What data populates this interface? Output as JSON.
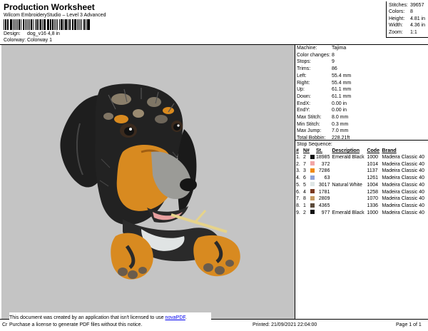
{
  "header": {
    "title": "Production Worksheet",
    "subtitle": "Wilcom EmbroideryStudio – Level 3 Advanced",
    "design_label": "Design:",
    "design_value": "dog_v16 4,8 in",
    "colorway_label": "Colorway:",
    "colorway_value": "Colorway 1"
  },
  "stats": [
    {
      "label": "Stitches:",
      "value": "39657"
    },
    {
      "label": "Colors:",
      "value": "8"
    },
    {
      "label": "Height:",
      "value": "4.81 in"
    },
    {
      "label": "Width:",
      "value": "4.36 in"
    },
    {
      "label": "Zoom:",
      "value": "1:1"
    }
  ],
  "machine_info": [
    {
      "label": "Machine:",
      "value": "Tajima"
    },
    {
      "label": "Color changes:",
      "value": "8"
    },
    {
      "label": "Stops:",
      "value": "9"
    },
    {
      "label": "Trims:",
      "value": "86"
    },
    {
      "label": "Left:",
      "value": "55.4 mm"
    },
    {
      "label": "Right:",
      "value": "55.4 mm"
    },
    {
      "label": "Up:",
      "value": "61.1 mm"
    },
    {
      "label": "Down:",
      "value": "61.1 mm"
    },
    {
      "label": "EndX:",
      "value": "0.00 in"
    },
    {
      "label": "EndY:",
      "value": "0.00 in"
    },
    {
      "label": "Max Stitch:",
      "value": "8.0 mm"
    },
    {
      "label": "Min Stitch:",
      "value": "0.3 mm"
    },
    {
      "label": "Max Jump:",
      "value": "7.0 mm"
    },
    {
      "label": "Total Bobbin:",
      "value": "228.21ft"
    }
  ],
  "stop_sequence": {
    "title": "Stop Sequence:",
    "columns": [
      "#",
      "N#",
      "",
      "St.",
      "Description",
      "Code",
      "Brand"
    ],
    "rows": [
      {
        "num": "1.",
        "n": "2",
        "color": "#111111",
        "st": "18985",
        "desc": "Emerald Black",
        "code": "1000",
        "brand": "Madeira Classic 40"
      },
      {
        "num": "2.",
        "n": "7",
        "color": "#f2a6a6",
        "st": "372",
        "desc": "",
        "code": "1014",
        "brand": "Madeira Classic 40"
      },
      {
        "num": "3.",
        "n": "3",
        "color": "#ef8a12",
        "st": "7286",
        "desc": "",
        "code": "1137",
        "brand": "Madeira Classic 40"
      },
      {
        "num": "4.",
        "n": "6",
        "color": "#8fa3d8",
        "st": "63",
        "desc": "",
        "code": "1261",
        "brand": "Madeira Classic 40"
      },
      {
        "num": "5.",
        "n": "5",
        "color": "#dfe6e6",
        "st": "3017",
        "desc": "Natural White",
        "code": "1004",
        "brand": "Madeira Classic 40"
      },
      {
        "num": "6.",
        "n": "4",
        "color": "#7a3a22",
        "st": "1781",
        "desc": "",
        "code": "1258",
        "brand": "Madeira Classic 40"
      },
      {
        "num": "7.",
        "n": "8",
        "color": "#c69a62",
        "st": "2809",
        "desc": "",
        "code": "1070",
        "brand": "Madeira Classic 40"
      },
      {
        "num": "8.",
        "n": "1",
        "color": "#5b4a3a",
        "st": "4365",
        "desc": "",
        "code": "1336",
        "brand": "Madeira Classic 40"
      },
      {
        "num": "9.",
        "n": "2",
        "color": "#111111",
        "st": "977",
        "desc": "Emerald Black",
        "code": "1000",
        "brand": "Madeira Classic 40"
      }
    ]
  },
  "footer": {
    "notice_line1_pre": "This document was created by an application that isn't licensed to use ",
    "notice_link": "novaPDF",
    "notice_line1_post": ".",
    "notice_line2": "Purchase a license to generate PDF files without this notice.",
    "left_text": "Cr",
    "printed": "Printed: 21/09/2021 22:04:00",
    "page": "Page 1 of 1"
  },
  "colors": {
    "design_bg": "#c4c4c4",
    "link": "#0000ee"
  }
}
